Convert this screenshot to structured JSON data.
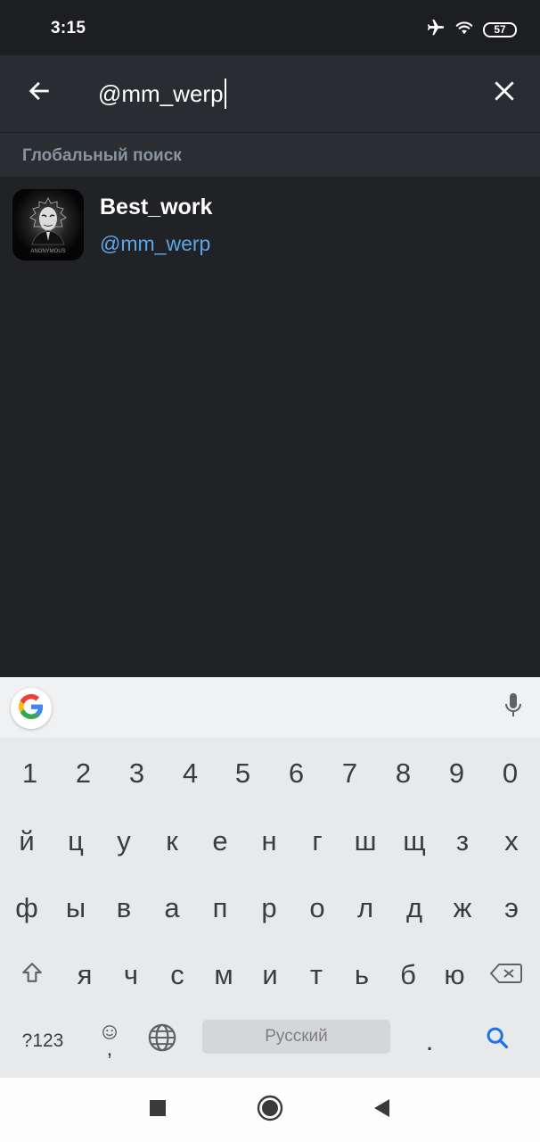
{
  "status_bar": {
    "time": "3:15",
    "battery": "57",
    "icons": [
      "airplane-icon",
      "wifi-icon",
      "battery-icon"
    ]
  },
  "search": {
    "query": "@mm_werp",
    "back_icon": "arrow-left-icon",
    "clear_icon": "close-icon"
  },
  "section": {
    "title": "Глобальный поиск"
  },
  "results": [
    {
      "name": "Best_work",
      "username": "@mm_werp",
      "avatar_text": "ANONYMOUS"
    }
  ],
  "keyboard": {
    "number_row": [
      "1",
      "2",
      "3",
      "4",
      "5",
      "6",
      "7",
      "8",
      "9",
      "0"
    ],
    "row1": [
      "й",
      "ц",
      "у",
      "к",
      "е",
      "н",
      "г",
      "ш",
      "щ",
      "з",
      "х"
    ],
    "row2": [
      "ф",
      "ы",
      "в",
      "а",
      "п",
      "р",
      "о",
      "л",
      "д",
      "ж",
      "э"
    ],
    "row3": [
      "я",
      "ч",
      "с",
      "м",
      "и",
      "т",
      "ь",
      "б",
      "ю"
    ],
    "symbols_label": "?123",
    "comma": ",",
    "space_label": "Русский",
    "period": ".",
    "accent_color": "#1a73e8"
  },
  "colors": {
    "background": "#212226",
    "header": "#292c31",
    "link": "#5ca6e8"
  }
}
